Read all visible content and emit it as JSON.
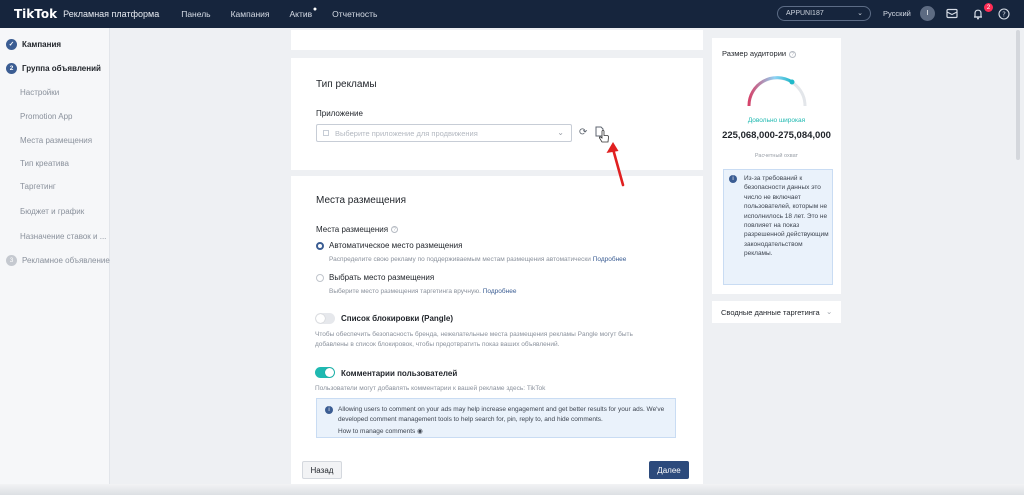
{
  "header": {
    "logo": "TikTok",
    "platform": "Рекламная платформа",
    "nav": [
      "Панель",
      "Кампания",
      "Актив",
      "Отчетность"
    ],
    "account": "APPUNI187",
    "language": "Русский",
    "avatar_letter": "I",
    "notif_count": "2"
  },
  "sidebar": {
    "steps": [
      {
        "label": "Кампания",
        "icon": "✓"
      },
      {
        "label": "Группа объявлений",
        "icon": "2"
      },
      {
        "label": "Рекламное объявление",
        "icon": "3"
      }
    ],
    "sub_items": [
      "Настройки",
      "Promotion App",
      "Места размещения",
      "Тип креатива",
      "Таргетинг",
      "Бюджет и график",
      "Назначение ставок и ..."
    ]
  },
  "ad_type": {
    "title": "Тип рекламы",
    "app_label": "Приложение",
    "app_placeholder": "Выберите приложение для продвижения"
  },
  "placements": {
    "title": "Места размещения",
    "label": "Места размещения",
    "auto_label": "Автоматическое место размещения",
    "auto_desc": "Распределите свою рекламу по поддерживаемым местам размещения автоматически",
    "more_link": "Подробнее",
    "manual_label": "Выбрать место размещения",
    "manual_desc": "Выберите место размещения таргетинга вручную.",
    "blocklist_label": "Список блокировки (Pangle)",
    "blocklist_desc": "Чтобы обеспечить безопасность бренда, нежелательные места размещения рекламы Pangle могут быть добавлены в список блокировок, чтобы предотвратить показ ваших объявлений.",
    "comments_label": "Комментарии пользователей",
    "comments_desc": "Пользователи могут добавлять комментарии к вашей рекламе здесь: TikTok",
    "comments_notice": "Allowing users to comment on your ads may help increase engagement and get better results for your ads. We've developed comment management tools to help search for, pin, reply to, and hide comments.",
    "comments_more": "How to manage comments"
  },
  "buttons": {
    "back": "Назад",
    "next": "Далее"
  },
  "audience": {
    "title": "Размер аудитории",
    "gauge_label": "Довольно широкая",
    "value": "225,068,000-275,084,000",
    "est_label": "Расчетный охват",
    "note": "Из-за требований к безопасности данных это число не включает пользователей, которым не исполнилось 18 лет. Это не повлияет на показ разрешенной действующим законодательством рекламы."
  },
  "targeting_summary": "Сводные данные таргетинга",
  "colors": {
    "accent": "#2c4a7c",
    "teal": "#1fb9b1",
    "nav_bg": "#16253d"
  }
}
